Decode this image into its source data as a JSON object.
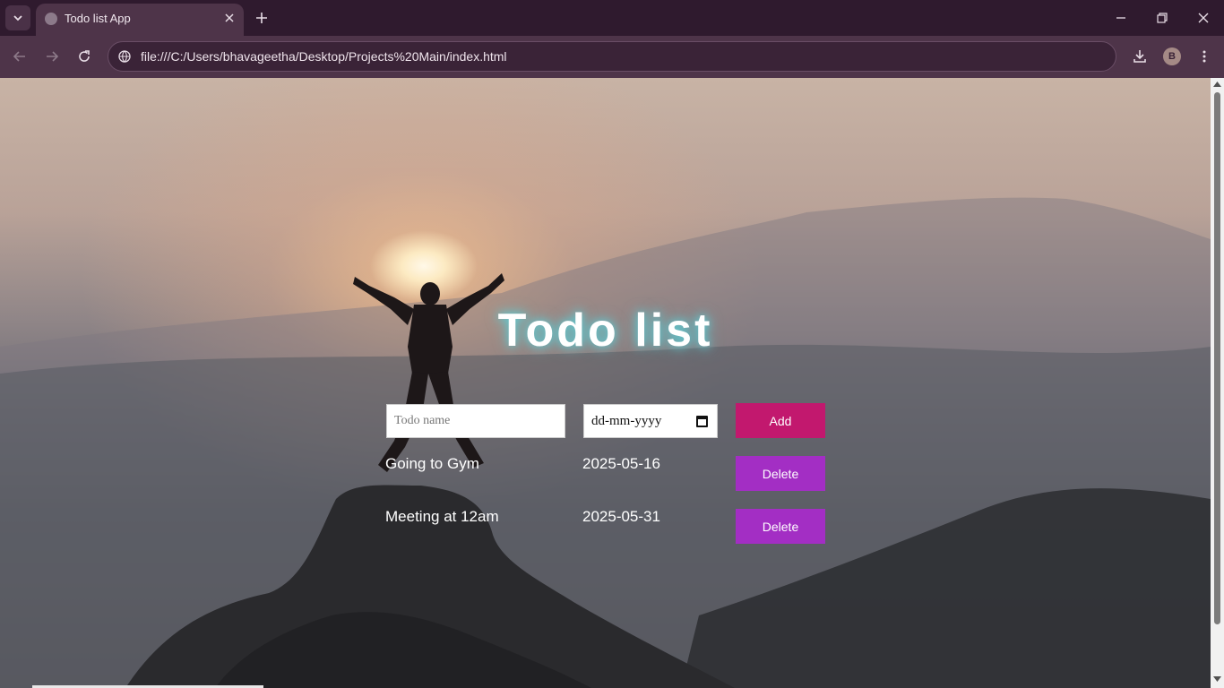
{
  "browser": {
    "tab_title": "Todo list App",
    "url": "file:///C:/Users/bhavageetha/Desktop/Projects%20Main/index.html",
    "profile_initial": "B",
    "icons": [
      "tab-list-icon",
      "globe-icon",
      "close-icon",
      "plus-icon",
      "minimize-icon",
      "restore-icon",
      "back-icon",
      "forward-icon",
      "reload-icon",
      "download-icon",
      "kebab-menu-icon"
    ]
  },
  "page": {
    "title": "Todo list",
    "form": {
      "name_placeholder": "Todo name",
      "date_placeholder": "dd-mm-yyyy",
      "add_label": "Add"
    },
    "todos": [
      {
        "name": "Going to Gym",
        "date": "2025-05-16",
        "delete_label": "Delete"
      },
      {
        "name": "Meeting at 12am",
        "date": "2025-05-31",
        "delete_label": "Delete"
      }
    ],
    "colors": {
      "add_button": "#c2186e",
      "delete_button": "#a32ec4",
      "title_glow": "#5ad0d8"
    }
  }
}
